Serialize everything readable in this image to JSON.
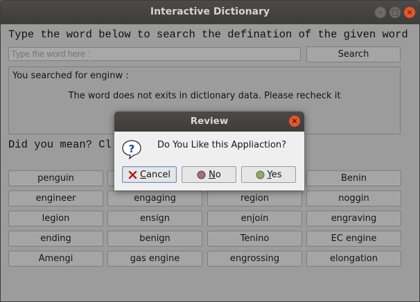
{
  "window": {
    "title": "Interactive Dictionary"
  },
  "main": {
    "heading": "Type the word below to search the defination of the given word",
    "search_placeholder": "Type the word here :",
    "search_button": "Search",
    "result_line1": "You searched for enginw :",
    "result_line2": "The word does not exits in dictionary data. Please recheck it",
    "did_you_mean": "Did you mean? Cl",
    "suggestions": [
      [
        "penguin",
        "",
        "",
        "Benin"
      ],
      [
        "engineer",
        "engaging",
        "region",
        "noggin"
      ],
      [
        "legion",
        "ensign",
        "enjoin",
        "engraving"
      ],
      [
        "ending",
        "benign",
        "Tenino",
        "EC engine"
      ],
      [
        "Amengi",
        "gas engine",
        "engrossing",
        "elongation"
      ]
    ]
  },
  "dialog": {
    "title": "Review",
    "message": "Do You Like this Appliaction?",
    "cancel_mnemonic": "C",
    "cancel_rest": "ancel",
    "no_mnemonic": "N",
    "no_rest": "o",
    "yes_mnemonic": "Y",
    "yes_rest": "es"
  },
  "colors": {
    "close": "#e9552b",
    "background": "#9c9c9c",
    "dialog_bg": "#efefef"
  }
}
